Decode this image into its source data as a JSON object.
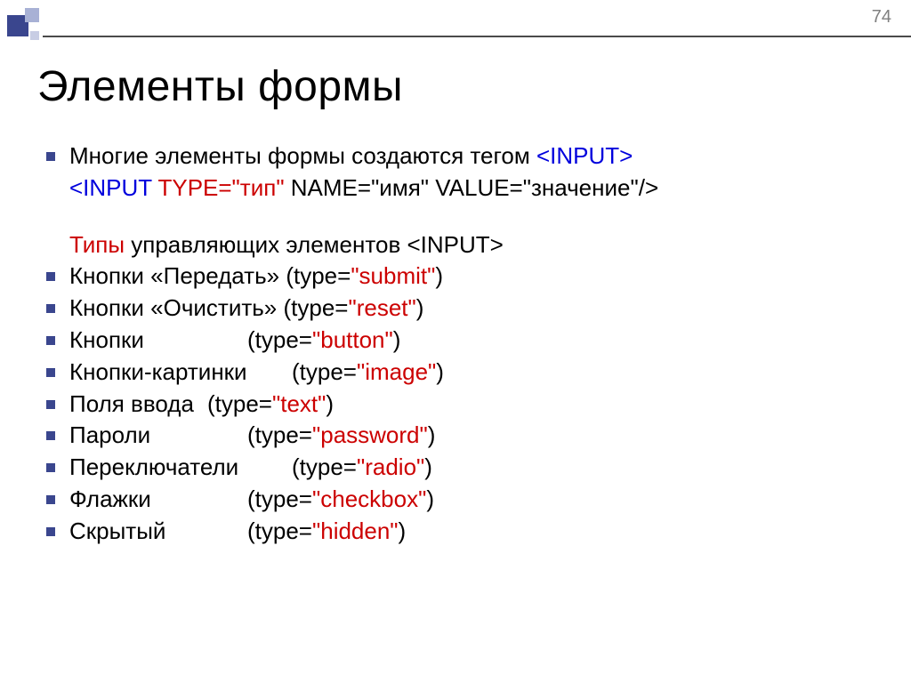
{
  "page_number": "74",
  "title": "Элементы формы",
  "intro": {
    "text_before": "Многие элементы формы создаются тегом ",
    "tag": "<INPUT>",
    "syntax": {
      "open_tag": "<INPUT ",
      "attr1_name": "TYPE=\"",
      "attr1_val": "тип",
      "mid1": "\"  ",
      "name_attr": "NAME=\"имя\" VALUE=\"значение\"/>"
    }
  },
  "subtitle": {
    "types_word": "Типы",
    "rest": " управляющих элементов <INPUT>"
  },
  "items": [
    {
      "label": "Кнопки «Передать» ",
      "type_word": "(type=",
      "value": "\"submit\"",
      "close": ")"
    },
    {
      "label": "Кнопки «Очистить» ",
      "type_word": "(type=",
      "value": "\"reset\"",
      "close": ")"
    },
    {
      "label": "Кнопки",
      "spacer": "tab1",
      "type_word": "(type=",
      "value": "\"button\"",
      "close": ")"
    },
    {
      "label": "Кнопки-картинки",
      "spacer": "tab2",
      "type_word": "(type=",
      "value": "\"image\"",
      "close": ")"
    },
    {
      "label": "Поля ввода",
      "spacer": "tab3",
      "type_word": "(type=",
      "value": "\"text\"",
      "close": ")"
    },
    {
      "label": "Пароли",
      "spacer": "tab1",
      "type_word": "(type=",
      "value": "\"password\"",
      "close": ")"
    },
    {
      "label": "Переключатели",
      "spacer": "tab2",
      "type_word": "(type=",
      "value": "\"radio\"",
      "close": ")"
    },
    {
      "label": "Флажки",
      "spacer": "tab1",
      "type_word": "(type=",
      "value": "\"checkbox\"",
      "close": ")"
    },
    {
      "label": "Скрытый",
      "spacer": "tab1",
      "type_word": "(type=",
      "value": "\"hidden\"",
      "close": ")"
    }
  ]
}
